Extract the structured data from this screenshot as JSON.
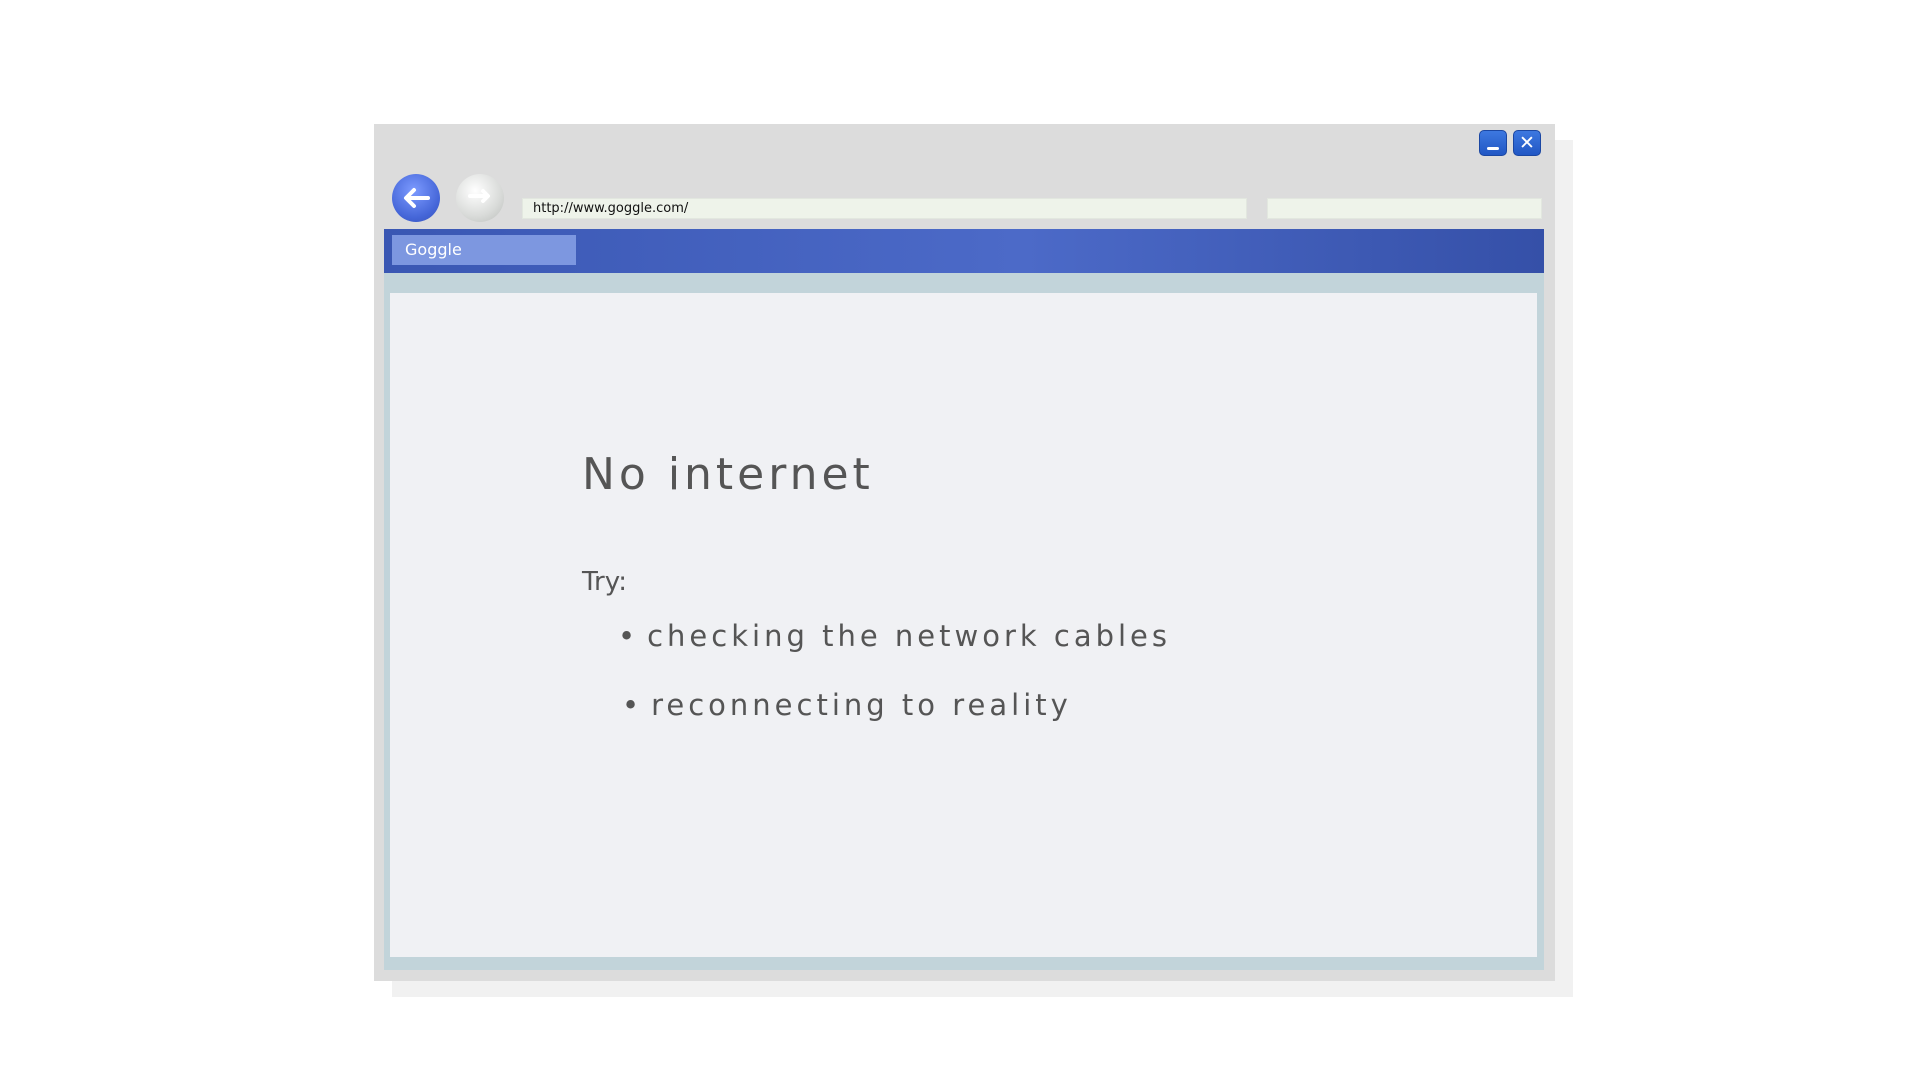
{
  "window": {
    "minimize_label": "",
    "close_label": "✕"
  },
  "toolbar": {
    "back_icon": "arrow-left-icon",
    "forward_icon": "arrow-right-icon",
    "address_value": "http://www.goggle.com/",
    "search_value": ""
  },
  "tabs": [
    {
      "label": "Goggle"
    }
  ],
  "page": {
    "heading": "No internet",
    "try_label": "Try:",
    "bullet": "•",
    "suggestions": [
      "checking the network cables",
      "reconnecting to reality"
    ]
  },
  "colors": {
    "accent": "#3a57b3",
    "tab": "#7d97e0",
    "frame": "#c2d4da",
    "page_background": "#f0f1f4",
    "text": "#555555"
  }
}
